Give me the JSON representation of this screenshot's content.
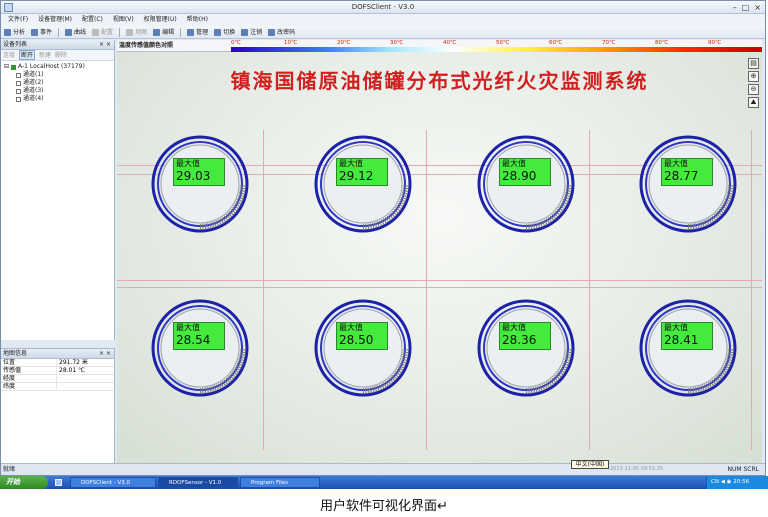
{
  "window": {
    "title": "DOFSClient - V3.0",
    "controls": [
      "–",
      "□",
      "×"
    ]
  },
  "menu": [
    "文件(F)",
    "设备管理(M)",
    "配置(C)",
    "视图(V)",
    "权限管理(U)",
    "帮助(H)"
  ],
  "toolbar": [
    {
      "label": "分析",
      "enabled": true
    },
    {
      "label": "事件",
      "enabled": true
    },
    {
      "label": "曲线",
      "enabled": true
    },
    {
      "label": "配置",
      "enabled": false
    },
    {
      "label": "地图",
      "enabled": false
    },
    {
      "label": "编辑",
      "enabled": true
    },
    {
      "label": "管理",
      "enabled": true
    },
    {
      "label": "切换",
      "enabled": true
    },
    {
      "label": "注销",
      "enabled": true
    },
    {
      "label": "改密码",
      "enabled": true
    }
  ],
  "device_panel": {
    "title": "设备列表",
    "close": "× ×",
    "tools": [
      {
        "label": "连接",
        "active": false
      },
      {
        "label": "断开",
        "active": true
      },
      {
        "label": "新建",
        "active": false
      },
      {
        "label": "删除",
        "active": false
      }
    ],
    "host": "A-1 LocalHost (37179)",
    "channels": [
      "通道(1)",
      "通道(2)",
      "通道(3)",
      "通道(4)"
    ]
  },
  "info_panel": {
    "title": "地图信息",
    "rows": [
      {
        "key": "位置",
        "value": "291.72 米"
      },
      {
        "key": "传感值",
        "value": "28.01 ℃"
      },
      {
        "key": "经度",
        "value": ""
      },
      {
        "key": "纬度",
        "value": ""
      }
    ]
  },
  "legend": {
    "label": "温度传感值颜色对照",
    "ticks": [
      "0℃",
      "10℃",
      "20℃",
      "30℃",
      "40℃",
      "50℃",
      "60℃",
      "70℃",
      "80℃",
      "90℃"
    ]
  },
  "system_title": "镇海国储原油储罐分布式光纤火灾监测系统",
  "max_label": "最大值",
  "tanks": [
    "29.03",
    "29.12",
    "28.90",
    "28.77",
    "28.54",
    "28.50",
    "28.36",
    "28.41"
  ],
  "right_tools": [
    "▤",
    "⊕",
    "⊖",
    "⛰"
  ],
  "status": {
    "left": "就绪",
    "right": "NUM  SCRL"
  },
  "ime": "中文(中国)",
  "timestamp": "2013-11-05 09:51:25",
  "taskbar": {
    "start": "开始",
    "tasks": [
      "DOFSClient - V3.0",
      "RDOFSensor - V1.0",
      "Program Files"
    ],
    "tray": "CN  ◀ ◉  20:56"
  },
  "caption": "用户软件可视化界面↵"
}
